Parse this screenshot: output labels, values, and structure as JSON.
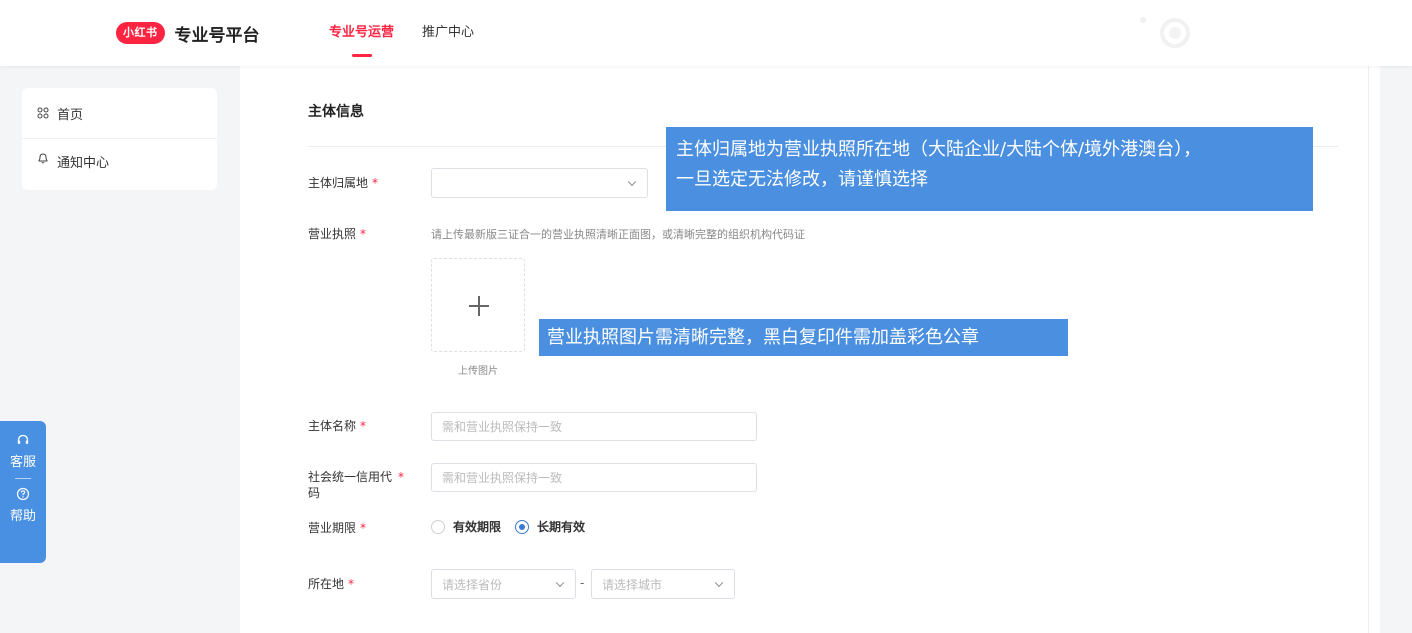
{
  "header": {
    "logo_text": "小红书",
    "brand_name": "专业号平台",
    "nav": [
      {
        "label": "专业号运营",
        "active": true
      },
      {
        "label": "推广中心",
        "active": false
      }
    ]
  },
  "sidebar": {
    "items": [
      {
        "label": "首页",
        "icon": "grid-icon"
      },
      {
        "label": "通知中心",
        "icon": "bell-icon"
      }
    ]
  },
  "float": {
    "service_label": "客服",
    "help_label": "帮助"
  },
  "form": {
    "section_title": "主体信息",
    "required_mark": "*",
    "region": {
      "label": "主体归属地",
      "value": ""
    },
    "license": {
      "label": "营业执照",
      "hint": "请上传最新版三证合一的营业执照清晰正面图，或清晰完整的组织机构代码证",
      "upload_label": "上传图片"
    },
    "entity_name": {
      "label": "主体名称",
      "placeholder": "需和营业执照保持一致"
    },
    "credit_code": {
      "label_line1": "社会统一信用代",
      "label_line2": "码",
      "placeholder": "需和营业执照保持一致"
    },
    "term": {
      "label": "营业期限",
      "options": [
        {
          "label": "有效期限",
          "checked": false
        },
        {
          "label": "长期有效",
          "checked": true
        }
      ]
    },
    "location": {
      "label": "所在地",
      "province_placeholder": "请选择省份",
      "separator": "-",
      "city_placeholder": "请选择城市"
    }
  },
  "callouts": {
    "region_line1": "主体归属地为营业执照所在地（大陆企业/大陆个体/境外港澳台），",
    "region_line2": "一旦选定无法修改，请谨慎选择",
    "license": "营业执照图片需清晰完整，黑白复印件需加盖彩色公章"
  },
  "colors": {
    "brand": "#ff2442",
    "callout": "#4a8fe0",
    "radio_active": "#3a7bd5",
    "float_bar": "#4a90e2"
  }
}
